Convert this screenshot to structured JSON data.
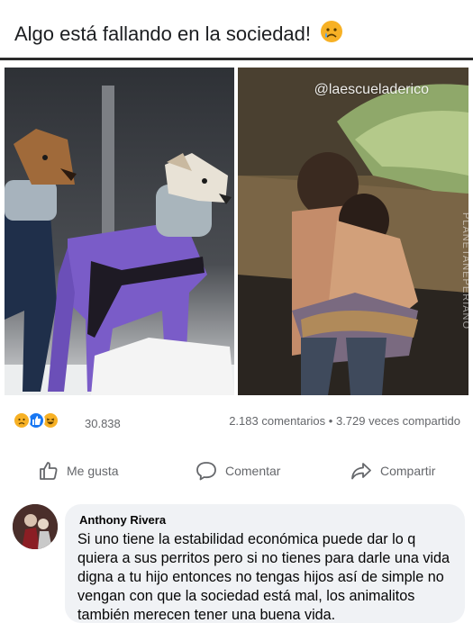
{
  "post": {
    "title": "Algo está fallando en la sociedad!",
    "title_emoji": "sad-tear-emoji"
  },
  "media": {
    "left_image": "greyhound-dogs-in-purple-sweaters",
    "right_image": "two-children-hugging-on-street",
    "watermark": "@laescueladerico",
    "vertical_watermark": "PLANETANEPERIANO"
  },
  "stats": {
    "reaction_icons": [
      "sad-reaction-icon",
      "like-reaction-icon",
      "haha-reaction-icon"
    ],
    "reaction_count": "30.838",
    "comments": "2.183 comentarios",
    "separator": "•",
    "shares": "3.729 veces compartido"
  },
  "actions": {
    "like_label": "Me gusta",
    "comment_label": "Comentar",
    "share_label": "Compartir"
  },
  "comment": {
    "author": "Anthony Rivera",
    "text": "Si uno tiene la estabilidad económica puede dar lo q quiera a sus perritos pero si no tienes para darle una vida digna a tu hijo entonces no tengas hijos así de simple no vengan con que la sociedad está mal, los animalitos también merecen tener una buena vida."
  },
  "colors": {
    "facebook_blue": "#1877f2",
    "reaction_yellow": "#f7b125",
    "muted_text": "#65676b",
    "bubble_bg": "#f0f2f5",
    "sweater_purple": "#7a5cc8"
  }
}
